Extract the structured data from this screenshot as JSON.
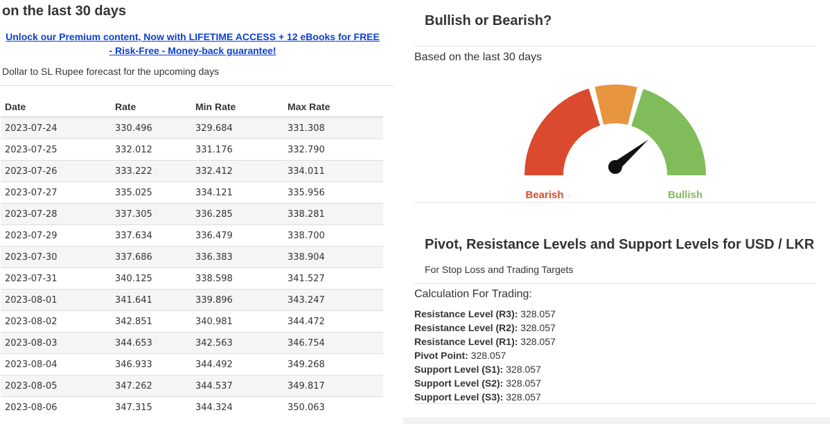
{
  "left": {
    "heading": "on the last 30 days",
    "promo_line1": "Unlock our Premium content, Now with LIFETIME ACCESS + 12 eBooks for FREE",
    "promo_line2": "- Risk-Free - Money-back guarantee!",
    "subtitle": "Dollar to SL Rupee forecast for the upcoming days",
    "table": {
      "headers": [
        "Date",
        "Rate",
        "Min Rate",
        "Max Rate"
      ],
      "rows": [
        [
          "2023-07-24",
          "330.496",
          "329.684",
          "331.308"
        ],
        [
          "2023-07-25",
          "332.012",
          "331.176",
          "332.790"
        ],
        [
          "2023-07-26",
          "333.222",
          "332.412",
          "334.011"
        ],
        [
          "2023-07-27",
          "335.025",
          "334.121",
          "335.956"
        ],
        [
          "2023-07-28",
          "337.305",
          "336.285",
          "338.281"
        ],
        [
          "2023-07-29",
          "337.634",
          "336.479",
          "338.700"
        ],
        [
          "2023-07-30",
          "337.686",
          "336.383",
          "338.904"
        ],
        [
          "2023-07-31",
          "340.125",
          "338.598",
          "341.527"
        ],
        [
          "2023-08-01",
          "341.641",
          "339.896",
          "343.247"
        ],
        [
          "2023-08-02",
          "342.851",
          "340.981",
          "344.472"
        ],
        [
          "2023-08-03",
          "344.653",
          "342.563",
          "346.754"
        ],
        [
          "2023-08-04",
          "346.933",
          "344.492",
          "349.268"
        ],
        [
          "2023-08-05",
          "347.262",
          "344.537",
          "349.817"
        ],
        [
          "2023-08-06",
          "347.315",
          "344.324",
          "350.063"
        ]
      ]
    }
  },
  "right": {
    "bull_title": "Bullish or Bearish?",
    "based_on": "Based on the last 30 days",
    "gauge": {
      "bearish_label": "Bearish",
      "bullish_label": "Bullish",
      "colors": {
        "bearish": "#db4a2f",
        "neutral": "#e8953f",
        "bullish": "#80bd5a",
        "needle": "#111111"
      },
      "needle_value": 0.78
    },
    "pivot_title": "Pivot, Resistance Levels and Support Levels for USD / LKR",
    "pivot_subtitle": "For Stop Loss and Trading Targets",
    "calc_title": "Calculation For Trading:",
    "levels": [
      {
        "label": "Resistance Level (R3):",
        "value": "328.057"
      },
      {
        "label": "Resistance Level (R2):",
        "value": "328.057"
      },
      {
        "label": "Resistance Level (R1):",
        "value": "328.057"
      },
      {
        "label": "Pivot Point:",
        "value": "328.057"
      },
      {
        "label": "Support Level (S1):",
        "value": "328.057"
      },
      {
        "label": "Support Level (S2):",
        "value": "328.057"
      },
      {
        "label": "Support Level (S3):",
        "value": "328.057"
      }
    ]
  },
  "colors": {
    "link": "#0b3fd3",
    "text": "#333333"
  }
}
